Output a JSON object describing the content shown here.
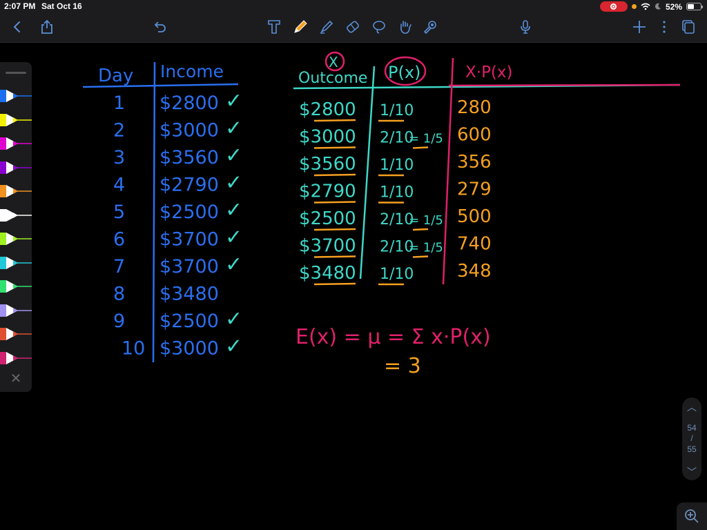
{
  "status_bar": {
    "time": "2:07 PM",
    "date": "Sat Oct 16",
    "battery": "52%",
    "battery_level": 0.52
  },
  "toolbar": {
    "left": [
      "back-icon",
      "share-icon",
      "undo-icon"
    ],
    "tools": [
      "text-tool-icon",
      "pencil-tool-icon",
      "highlighter-tool-icon",
      "eraser-tool-icon",
      "lasso-tool-icon",
      "hand-tool-icon",
      "laser-pointer-icon"
    ],
    "active_tool": "pencil-tool-icon",
    "right": [
      "microphone-icon",
      "add-icon",
      "more-icon",
      "pages-icon"
    ]
  },
  "pen_palette": {
    "colors": [
      "#1a6ef0",
      "#f2f000",
      "#e000d0",
      "#8a00d0",
      "#f09020",
      "#ffffff",
      "#a0f020",
      "#20c8d8",
      "#30e070",
      "#a090f0",
      "#e05030",
      "#d02070"
    ],
    "close_label": "✕"
  },
  "notes": {
    "left_table": {
      "headers": [
        "Day",
        "Income"
      ],
      "rows": [
        {
          "day": "1",
          "income": "$2800",
          "checked": true
        },
        {
          "day": "2",
          "income": "$3000",
          "checked": true
        },
        {
          "day": "3",
          "income": "$3560",
          "checked": true
        },
        {
          "day": "4",
          "income": "$2790",
          "checked": true
        },
        {
          "day": "5",
          "income": "$2500",
          "checked": true
        },
        {
          "day": "6",
          "income": "$3700",
          "checked": true
        },
        {
          "day": "7",
          "income": "$3700",
          "checked": true
        },
        {
          "day": "8",
          "income": "$3480",
          "checked": false
        },
        {
          "day": "9",
          "income": "$2500",
          "checked": true
        },
        {
          "day": "10",
          "income": "$3000",
          "checked": true
        }
      ],
      "check_mark": "✓"
    },
    "right_table": {
      "x_label": "X",
      "headers": [
        "Outcome",
        "P(x)",
        "X·P(x)"
      ],
      "rows": [
        {
          "outcome": "$2800",
          "p": "1/10",
          "p_simplified": "",
          "xp": "280"
        },
        {
          "outcome": "$3000",
          "p": "2/10",
          "p_simplified": "= 1/5",
          "xp": "600"
        },
        {
          "outcome": "$3560",
          "p": "1/10",
          "p_simplified": "",
          "xp": "356"
        },
        {
          "outcome": "$2790",
          "p": "1/10",
          "p_simplified": "",
          "xp": "279"
        },
        {
          "outcome": "$2500",
          "p": "2/10",
          "p_simplified": "= 1/5",
          "xp": "500"
        },
        {
          "outcome": "$3700",
          "p": "2/10",
          "p_simplified": "= 1/5",
          "xp": "740"
        },
        {
          "outcome": "$3480",
          "p": "1/10",
          "p_simplified": "",
          "xp": "348"
        }
      ]
    },
    "formula": {
      "line1": "E(x) = μ = Σ x·P(x)",
      "line2": "= 3"
    },
    "ink_colors": {
      "blue": "#2a6ff0",
      "teal": "#3ed8c8",
      "pink": "#e0206a",
      "orange": "#f5a020"
    }
  },
  "page_nav": {
    "current": "54",
    "separator": "/",
    "total": "55"
  }
}
